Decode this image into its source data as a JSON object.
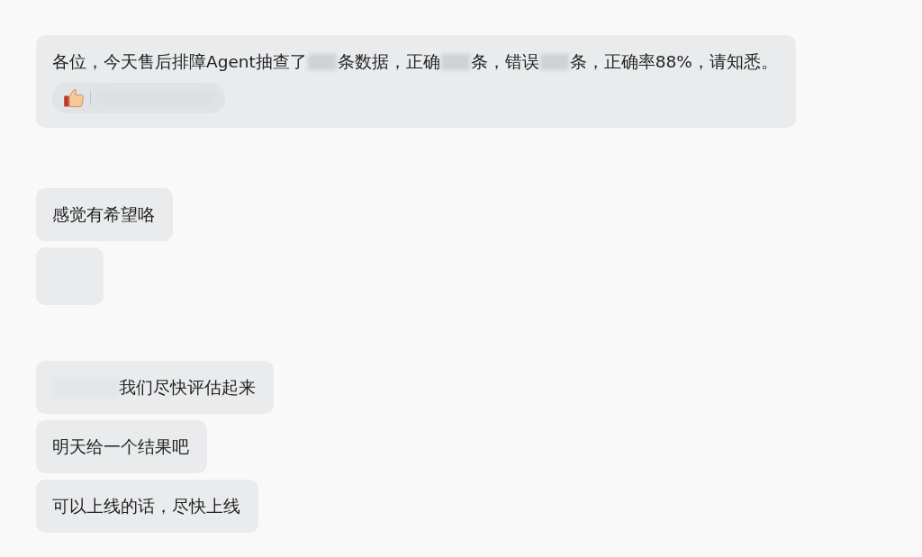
{
  "groups": [
    {
      "messages": [
        {
          "kind": "text",
          "parts": [
            {
              "kind": "text",
              "text": "各位，今天售后排障Agent抽查了"
            },
            {
              "kind": "redacted"
            },
            {
              "kind": "text",
              "text": "条数据，正确"
            },
            {
              "kind": "redacted"
            },
            {
              "kind": "text",
              "text": "条，错误"
            },
            {
              "kind": "redacted"
            },
            {
              "kind": "text",
              "text": "条，正确率88%，请知悉。"
            }
          ],
          "reaction": {
            "kind": "thumbs_up"
          }
        }
      ]
    },
    {
      "messages": [
        {
          "kind": "text",
          "parts": [
            {
              "kind": "text",
              "text": "感觉有希望咯"
            }
          ]
        },
        {
          "kind": "blurred"
        }
      ]
    },
    {
      "messages": [
        {
          "kind": "text",
          "parts": [
            {
              "kind": "mention_redacted"
            },
            {
              "kind": "text",
              "text": "我们尽快评估起来"
            }
          ]
        },
        {
          "kind": "text",
          "parts": [
            {
              "kind": "text",
              "text": "明天给一个结果吧"
            }
          ]
        },
        {
          "kind": "text",
          "parts": [
            {
              "kind": "text",
              "text": "可以上线的话，尽快上线"
            }
          ]
        }
      ]
    }
  ]
}
